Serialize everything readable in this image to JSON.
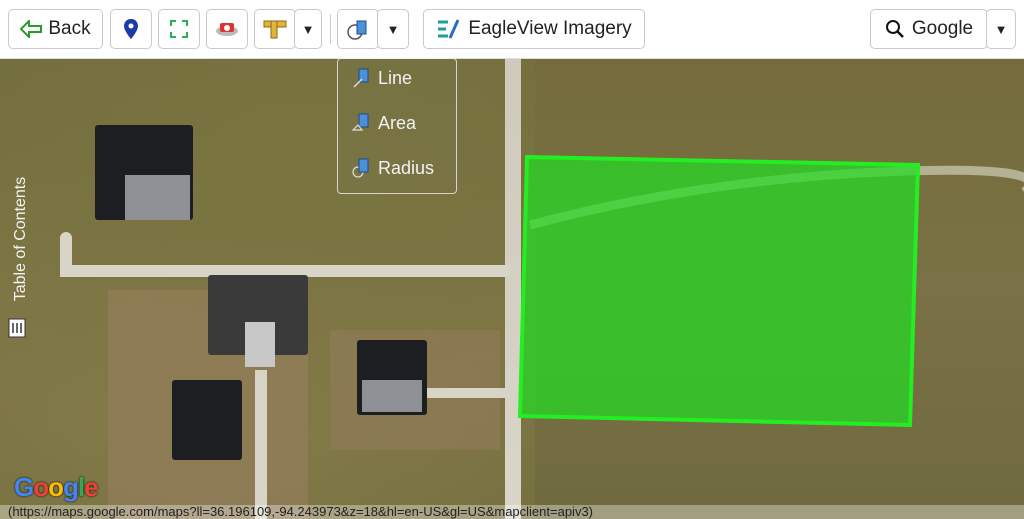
{
  "toolbar": {
    "back_label": "Back",
    "eagleview_label": "EagleView Imagery",
    "search_provider": "Google",
    "icons": [
      "location-pin-icon",
      "fullscreen-icon",
      "screenshot-icon",
      "ruler-icon",
      "measure-icon",
      "search-icon"
    ]
  },
  "measure_menu": {
    "items": [
      {
        "label": "Line"
      },
      {
        "label": "Area"
      },
      {
        "label": "Radius"
      }
    ]
  },
  "toc": {
    "label": "Table of Contents"
  },
  "map": {
    "provider_logo": "Google",
    "url": "(https://maps.google.com/maps?ll=36.196109,-94.243973&z=18&hl=en-US&gl=US&mapclient=apiv3)",
    "polygon_color": "#22dd22"
  }
}
